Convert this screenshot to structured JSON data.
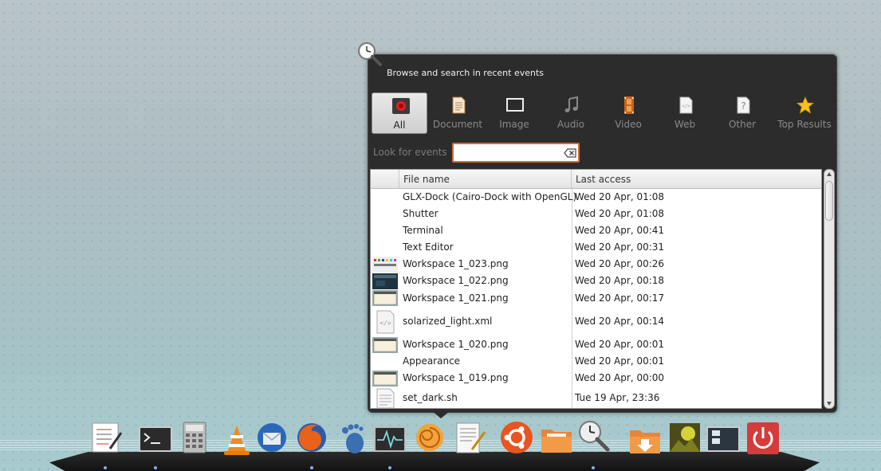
{
  "window": {
    "title": "Browse and search in recent events"
  },
  "tabs": [
    {
      "label": "All",
      "icon": "record-icon",
      "active": true
    },
    {
      "label": "Document",
      "icon": "document-icon",
      "active": false
    },
    {
      "label": "Image",
      "icon": "image-icon",
      "active": false
    },
    {
      "label": "Audio",
      "icon": "music-note-icon",
      "active": false
    },
    {
      "label": "Video",
      "icon": "film-strip-icon",
      "active": false
    },
    {
      "label": "Web",
      "icon": "web-page-icon",
      "active": false
    },
    {
      "label": "Other",
      "icon": "question-file-icon",
      "active": false
    },
    {
      "label": "Top Results",
      "icon": "star-icon",
      "active": false
    }
  ],
  "search": {
    "label": "Look for events",
    "value": "",
    "placeholder": ""
  },
  "table": {
    "columns": [
      "File name",
      "Last access"
    ],
    "rows": [
      {
        "name": "GLX-Dock (Cairo-Dock with OpenGL)",
        "date": "Wed 20 Apr, 01:08",
        "thumb": "none"
      },
      {
        "name": "Shutter",
        "date": "Wed 20 Apr, 01:08",
        "thumb": "none"
      },
      {
        "name": "Terminal",
        "date": "Wed 20 Apr, 00:41",
        "thumb": "none"
      },
      {
        "name": "Text Editor",
        "date": "Wed 20 Apr, 00:31",
        "thumb": "none"
      },
      {
        "name": "Workspace 1_023.png",
        "date": "Wed 20 Apr, 00:26",
        "thumb": "palette-thumbnail"
      },
      {
        "name": "Workspace 1_022.png",
        "date": "Wed 20 Apr, 00:18",
        "thumb": "dark-screenshot-thumbnail"
      },
      {
        "name": "Workspace 1_021.png",
        "date": "Wed 20 Apr, 00:17",
        "thumb": "window-screenshot-thumbnail"
      },
      {
        "name": "solarized_light.xml",
        "date": "Wed 20 Apr, 00:14",
        "thumb": "xml-file-icon"
      },
      {
        "name": "Workspace 1_020.png",
        "date": "Wed 20 Apr, 00:01",
        "thumb": "window-screenshot-thumbnail"
      },
      {
        "name": "Appearance",
        "date": "Wed 20 Apr, 00:01",
        "thumb": "none"
      },
      {
        "name": "Workspace 1_019.png",
        "date": "Wed 20 Apr, 00:00",
        "thumb": "window-screenshot-thumbnail"
      },
      {
        "name": "set_dark.sh",
        "date": "Tue 19 Apr, 23:36",
        "thumb": "text-file-icon"
      }
    ]
  },
  "dock": {
    "items": [
      "notes-icon",
      "terminal-icon",
      "calculator-icon",
      "vlc-icon",
      "thunderbird-icon",
      "firefox-icon",
      "gnome-foot-icon",
      "system-monitor-icon",
      "nautilus-shell-icon",
      "text-editor-icon",
      "ubuntu-logo-icon",
      "file-manager-icon",
      "clock-search-icon",
      "downloads-folder-icon",
      "image-viewer-icon",
      "workspace-switcher-icon",
      "power-icon"
    ]
  },
  "colors": {
    "applet_bg": "#2c2c2c",
    "search_border": "#d96a3a",
    "tab_active_bg": "#dcdcdc",
    "dock_bg": "#1a1a1a"
  }
}
